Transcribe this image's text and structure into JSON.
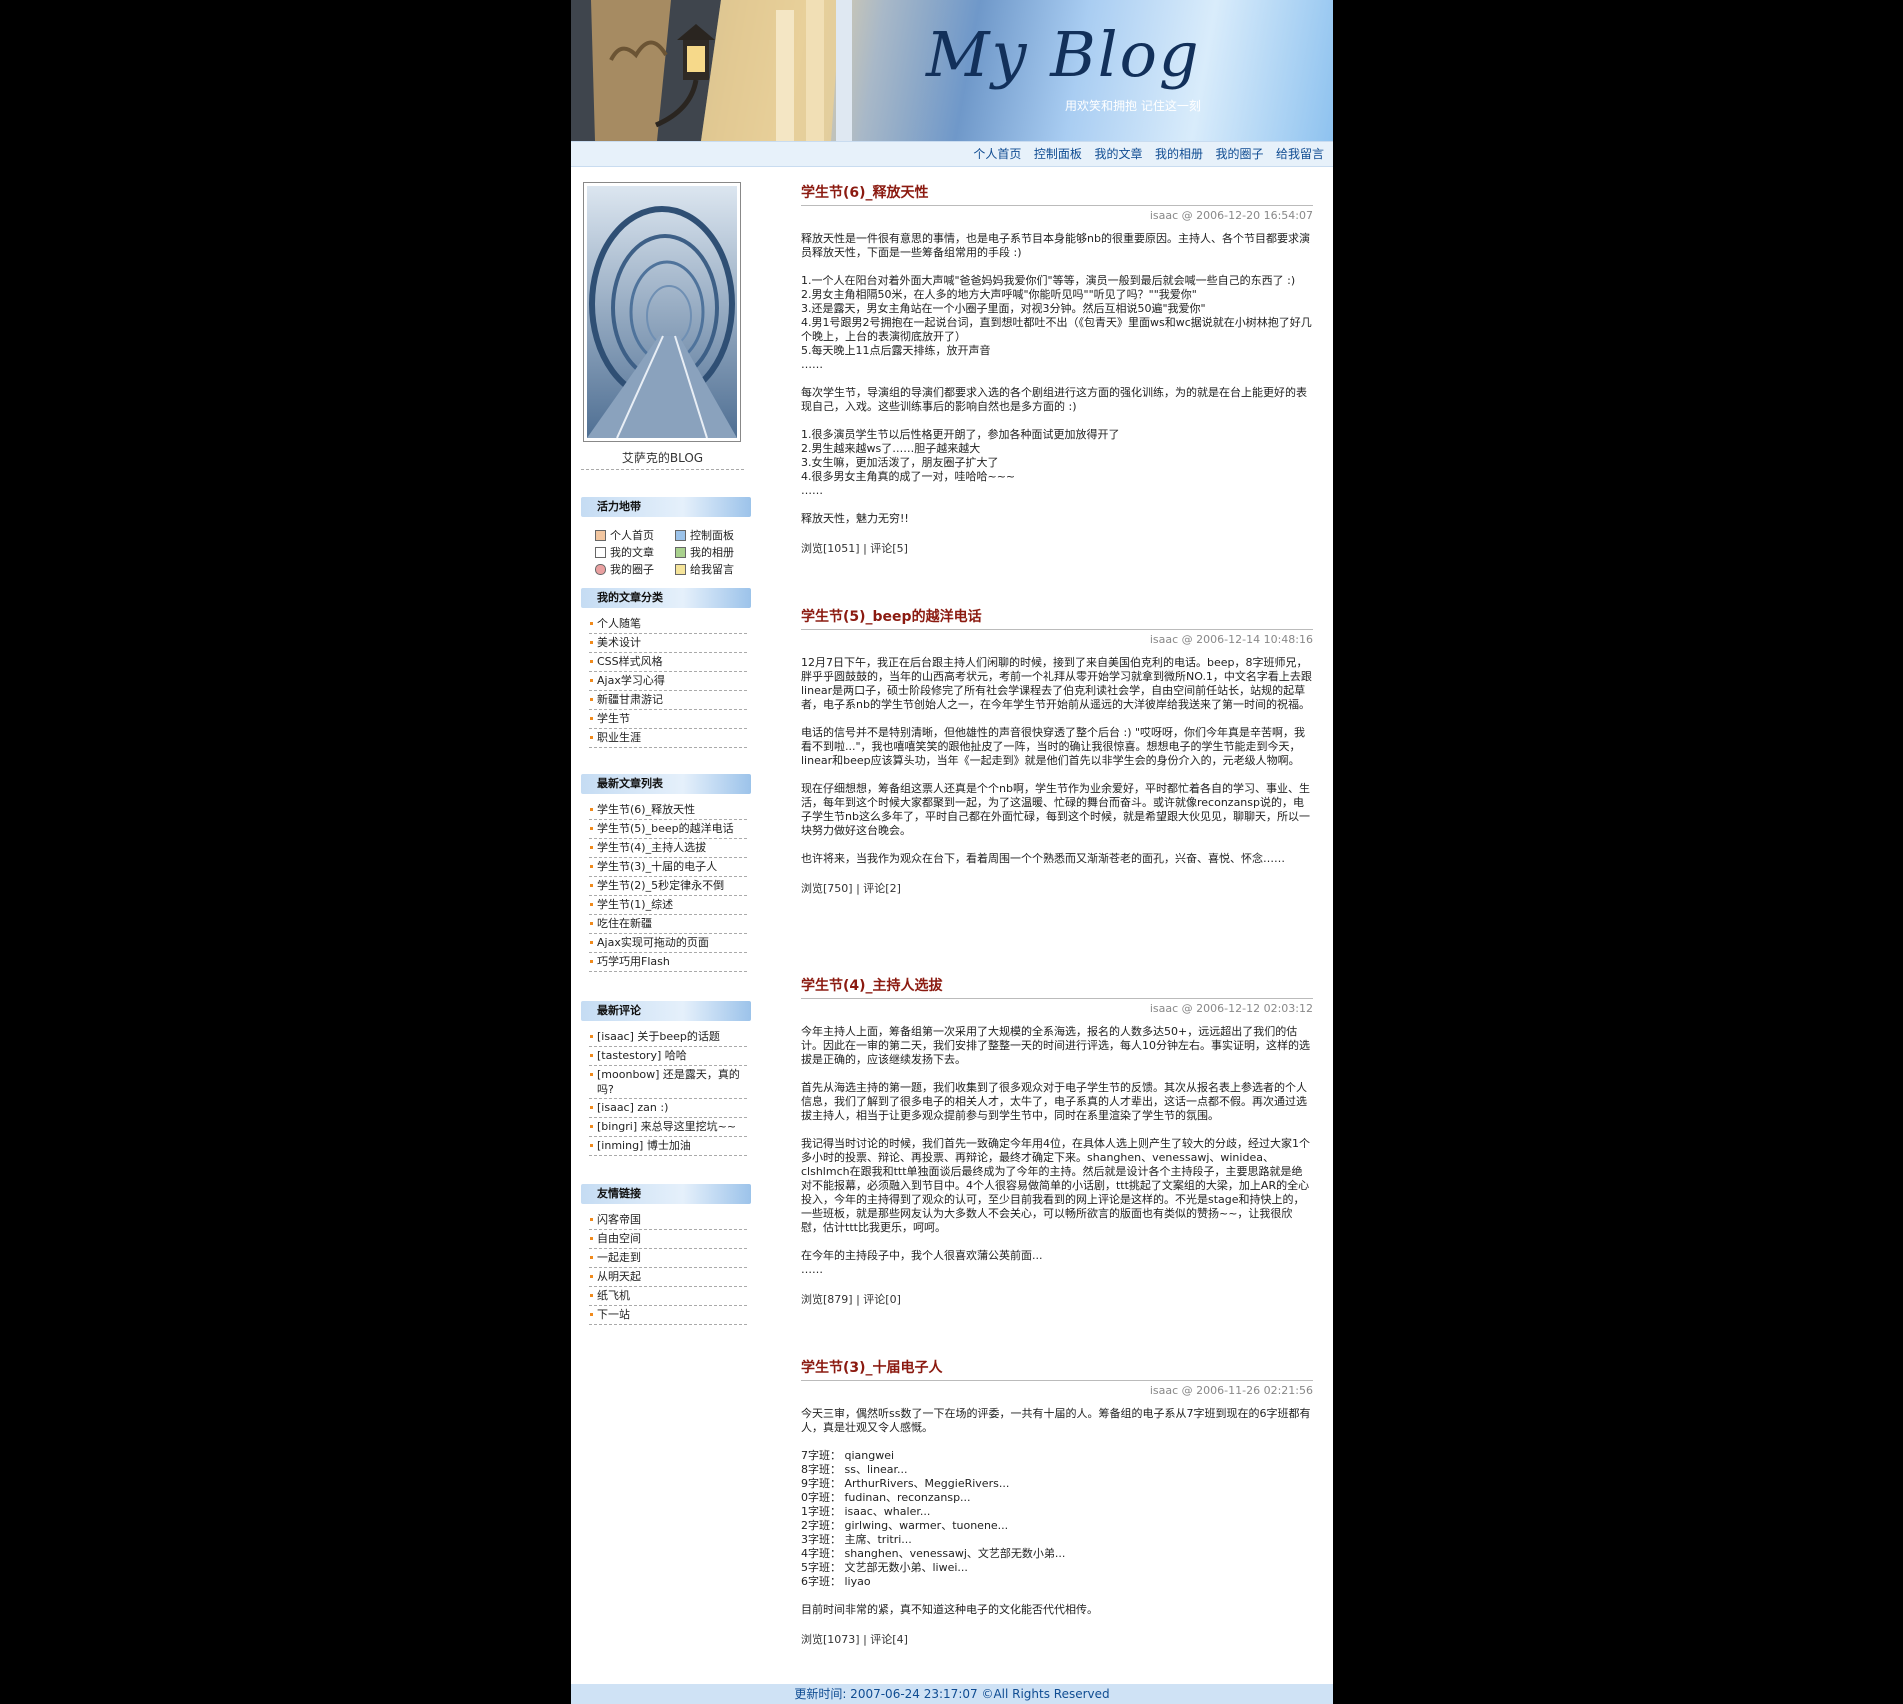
{
  "header": {
    "logo": "My Blog",
    "slogan": "用欢笑和拥抱  记住这一刻"
  },
  "topnav": [
    "个人首页",
    "控制面板",
    "我的文章",
    "我的相册",
    "我的圈子",
    "给我留言"
  ],
  "sidebar": {
    "blog_name": "艾萨克的BLOG",
    "quick_title": "活力地带",
    "quick_links": [
      "个人首页",
      "控制面板",
      "我的文章",
      "我的相册",
      "我的圈子",
      "给我留言"
    ],
    "category_title": "我的文章分类",
    "categories": [
      "个人随笔",
      "美术设计",
      "CSS样式风格",
      "Ajax学习心得",
      "新疆甘肃游记",
      "学生节",
      "职业生涯"
    ],
    "recent_title": "最新文章列表",
    "recent_posts": [
      "学生节(6)_释放天性",
      "学生节(5)_beep的越洋电话",
      "学生节(4)_主持人选拔",
      "学生节(3)_十届的电子人",
      "学生节(2)_5秒定律永不倒",
      "学生节(1)_综述",
      "吃住在新疆",
      "Ajax实现可拖动的页面",
      "巧学巧用Flash"
    ],
    "comments_title": "最新评论",
    "comments": [
      "[isaac] 关于beep的话题",
      "[tastestory] 哈哈",
      "[moonbow] 还是露天，真的吗?",
      "[isaac] zan :)",
      "[bingri] 来总导这里挖坑~~",
      "[inming] 博士加油"
    ],
    "links_title": "友情链接",
    "links": [
      "闪客帝国",
      "自由空间",
      "一起走到",
      "从明天起",
      "纸飞机",
      "下一站"
    ]
  },
  "posts": [
    {
      "title": "学生节(6)_释放天性",
      "meta": "isaac @ 2006-12-20 16:54:07",
      "paras": [
        "释放天性是一件很有意思的事情，也是电子系节目本身能够nb的很重要原因。主持人、各个节目都要求演员释放天性，下面是一些筹备组常用的手段 :)",
        "1.一个人在阳台对着外面大声喊\"爸爸妈妈我爱你们\"等等，演员一般到最后就会喊一些自己的东西了 :)\n2.男女主角相隔50米，在人多的地方大声呼喊\"你能听见吗\"\"听见了吗？\"\"我爱你\"\n3.还是露天，男女主角站在一个小圈子里面，对视3分钟。然后互相说50遍\"我爱你\"\n4.男1号跟男2号拥抱在一起说台词，直到想吐都吐不出（《包青天》里面ws和wc据说就在小树林抱了好几个晚上，上台的表演彻底放开了）\n5.每天晚上11点后露天排练，放开声音\n……",
        "每次学生节，导演组的导演们都要求入选的各个剧组进行这方面的强化训练，为的就是在台上能更好的表现自己，入戏。这些训练事后的影响自然也是多方面的 :)",
        "1.很多演员学生节以后性格更开朗了，参加各种面试更加放得开了\n2.男生越来越ws了……胆子越来越大\n3.女生嘛，更加活泼了，朋友圈子扩大了\n4.很多男女主角真的成了一对，哇哈哈~~~\n……",
        "释放天性，魅力无穷!!"
      ],
      "foot": "浏览[1051] | 评论[5]"
    },
    {
      "title": "学生节(5)_beep的越洋电话",
      "meta": "isaac @ 2006-12-14 10:48:16",
      "paras": [
        "12月7日下午，我正在后台跟主持人们闲聊的时候，接到了来自美国伯克利的电话。beep，8字班师兄，胖乎乎圆鼓鼓的，当年的山西高考状元，考前一个礼拜从零开始学习就拿到微所NO.1，中文名字看上去跟linear是两口子，硕士阶段修完了所有社会学课程去了伯克利读社会学，自由空间前任站长，站规的起草者，电子系nb的学生节创始人之一，在今年学生节开始前从遥远的大洋彼岸给我送来了第一时间的祝福。",
        "电话的信号并不是特别清晰，但他雄性的声音很快穿透了整个后台 :) \"哎呀呀，你们今年真是辛苦啊，我看不到啦...\"，我也嘻嘻笑笑的跟他扯皮了一阵，当时的确让我很惊喜。想想电子的学生节能走到今天，linear和beep应该算头功，当年《一起走到》就是他们首先以非学生会的身份介入的，元老级人物啊。",
        "现在仔细想想，筹备组这票人还真是个个nb啊，学生节作为业余爱好，平时都忙着各自的学习、事业、生活，每年到这个时候大家都聚到一起，为了这温暖、忙碌的舞台而奋斗。或许就像reconzansp说的，电子学生节nb这么多年了，平时自己都在外面忙碌，每到这个时候，就是希望跟大伙见见，聊聊天，所以一块努力做好这台晚会。",
        "也许将来，当我作为观众在台下，看着周围一个个熟悉而又渐渐苍老的面孔，兴奋、喜悦、怀念……"
      ],
      "foot": "浏览[750] | 评论[2]"
    },
    {
      "title": "学生节(4)_主持人选拔",
      "meta": "isaac @ 2006-12-12 02:03:12",
      "paras": [
        "今年主持人上面，筹备组第一次采用了大规模的全系海选，报名的人数多达50+，远远超出了我们的估计。因此在一审的第二天，我们安排了整整一天的时间进行评选，每人10分钟左右。事实证明，这样的选拔是正确的，应该继续发扬下去。",
        "首先从海选主持的第一题，我们收集到了很多观众对于电子学生节的反馈。其次从报名表上参选者的个人信息，我们了解到了很多电子的相关人才，太牛了，电子系真的人才辈出，这话一点都不假。再次通过选拔主持人，相当于让更多观众提前参与到学生节中，同时在系里渲染了学生节的氛围。",
        "我记得当时讨论的时候，我们首先一致确定今年用4位，在具体人选上则产生了较大的分歧，经过大家1个多小时的投票、辩论、再投票、再辩论，最终才确定下来。shanghen、venessawj、winidea、clshlmch在跟我和ttt单独面谈后最终成为了今年的主持。然后就是设计各个主持段子，主要思路就是绝对不能报幕，必须融入到节目中。4个人很容易做简单的小话剧，ttt挑起了文案组的大梁，加上AR的全心投入，今年的主持得到了观众的认可，至少目前我看到的网上评论是这样的。不光是stage和持快上的，一些班板，就是那些网友认为大多数人不会关心，可以畅所欲言的版面也有类似的赞扬~~，让我很欣慰，估计ttt比我更乐，呵呵。",
        "在今年的主持段子中，我个人很喜欢蒲公英前面...\n……"
      ],
      "foot": "浏览[879] | 评论[0]"
    },
    {
      "title": "学生节(3)_十届电子人",
      "meta": "isaac @ 2006-11-26 02:21:56",
      "paras": [
        "今天三审，偶然听ss数了一下在场的评委，一共有十届的人。筹备组的电子系从7字班到现在的6字班都有人，真是壮观又令人感慨。",
        "7字班：  qiangwei\n8字班：  ss、linear...\n9字班：  ArthurRivers、MeggieRivers...\n0字班：  fudinan、reconzansp...\n1字班：  isaac、whaler...\n2字班：  girlwing、warmer、tuonene...\n3字班：  主席、tritri...\n4字班：  shanghen、venessawj、文艺部无数小弟...\n5字班：  文艺部无数小弟、liwei...\n6字班：  liyao",
        "目前时间非常的紧，真不知道这种电子的文化能否代代相传。"
      ],
      "foot": "浏览[1073] | 评论[4]"
    }
  ],
  "footer": "更新时间: 2007-06-24 23:17:07 ©All Rights Reserved"
}
